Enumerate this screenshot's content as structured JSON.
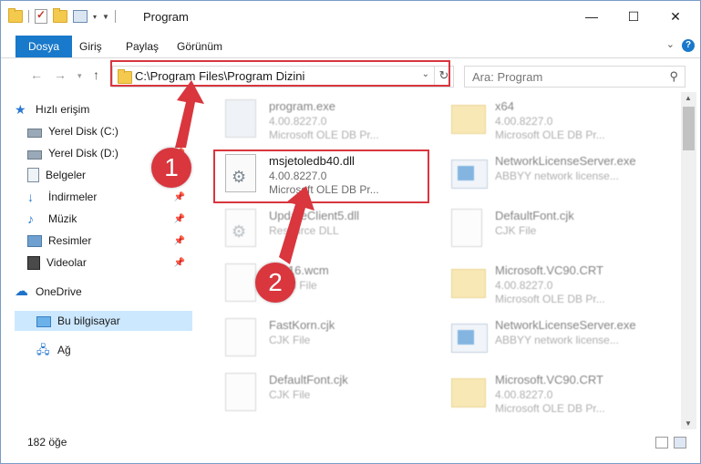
{
  "window": {
    "title": "Program",
    "minimize": "—",
    "maximize": "☐",
    "close": "✕"
  },
  "ribbon": {
    "tabs": [
      "Dosya",
      "Giriş",
      "Paylaş",
      "Görünüm"
    ]
  },
  "navigation": {
    "address": "C:\\Program Files\\Program Dizini",
    "search_placeholder": "Ara: Program"
  },
  "sidebar": {
    "items": [
      {
        "label": "Hızlı erişim",
        "icon": "star-icon"
      },
      {
        "label": "Yerel Disk (C:)",
        "icon": "drive-icon"
      },
      {
        "label": "Yerel Disk (D:)",
        "icon": "drive-icon"
      },
      {
        "label": "Belgeler",
        "icon": "documents-icon"
      },
      {
        "label": "İndirmeler",
        "icon": "downloads-icon"
      },
      {
        "label": "Müzik",
        "icon": "music-icon"
      },
      {
        "label": "Resimler",
        "icon": "pictures-icon"
      },
      {
        "label": "Videolar",
        "icon": "videos-icon"
      },
      {
        "label": "OneDrive",
        "icon": "cloud-icon"
      },
      {
        "label": "Bu bilgisayar",
        "icon": "computer-icon"
      },
      {
        "label": "Ağ",
        "icon": "network-icon"
      }
    ]
  },
  "files": [
    {
      "name": "program.exe",
      "line2": "4.00.8227.0",
      "line3": "Microsoft OLE DB Pr...",
      "icon": "exe-icon"
    },
    {
      "name": "x64",
      "line2": "4.00.8227.0",
      "line3": "Microsoft OLE DB Pr...",
      "icon": "folder-icon"
    },
    {
      "name": "msjetoledb40.dll",
      "line2": "4.00.8227.0",
      "line3": "Microsoft OLE DB Pr...",
      "icon": "dll-icon"
    },
    {
      "name": "NetworkLicenseServer.exe",
      "line2": "ABBYY network license...",
      "line3": "",
      "icon": "app-icon"
    },
    {
      "name": "UpdateClient5.dll",
      "line2": "Resource DLL",
      "line3": "",
      "icon": "dll-icon"
    },
    {
      "name": "DefaultFont.cjk",
      "line2": "CJK File",
      "line3": "",
      "icon": "file-icon"
    },
    {
      "name": "WP16.wcm",
      "line2": "WCM File",
      "line3": "",
      "icon": "file-icon"
    },
    {
      "name": "Microsoft.VC90.CRT",
      "line2": "4.00.8227.0",
      "line3": "Microsoft OLE DB Pr...",
      "icon": "folder-icon"
    },
    {
      "name": "FastKorn.cjk",
      "line2": "CJK File",
      "line3": "",
      "icon": "file-icon"
    },
    {
      "name": "NetworkLicenseServer.exe",
      "line2": "ABBYY network license...",
      "line3": "",
      "icon": "app-icon"
    },
    {
      "name": "DefaultFont.cjk",
      "line2": "CJK File",
      "line3": "",
      "icon": "file-icon"
    },
    {
      "name": "Microsoft.VC90.CRT",
      "line2": "4.00.8227.0",
      "line3": "Microsoft OLE DB Pr...",
      "icon": "folder-icon"
    }
  ],
  "status": {
    "count": "182 öğe"
  },
  "annotations": {
    "step1": "1",
    "step2": "2",
    "highlight_color": "#d9363e"
  }
}
